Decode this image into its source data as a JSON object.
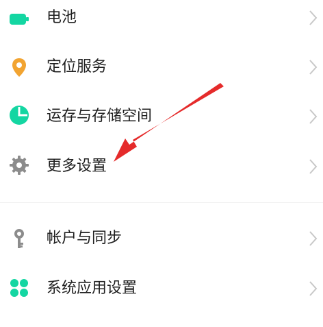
{
  "settings": {
    "items": [
      {
        "label": "电池",
        "icon": "battery-icon",
        "accent": "#14d6a2"
      },
      {
        "label": "定位服务",
        "icon": "location-pin-icon",
        "accent": "#f2a431"
      },
      {
        "label": "运存与存储空间",
        "icon": "pie-chart-icon",
        "accent": "#14d6a2"
      },
      {
        "label": "更多设置",
        "icon": "gear-icon",
        "accent": "#8c8c8c"
      },
      {
        "label": "帐户与同步",
        "icon": "key-icon",
        "accent": "#8c8c8c"
      },
      {
        "label": "系统应用设置",
        "icon": "grid-clover-icon",
        "accent": "#14d6a2"
      }
    ]
  },
  "annotation": {
    "arrow_color": "#e52b2b",
    "points_to": "更多设置"
  },
  "colors": {
    "background": "#ffffff",
    "text": "#1f1f1f",
    "chevron": "#c8c8c8"
  }
}
